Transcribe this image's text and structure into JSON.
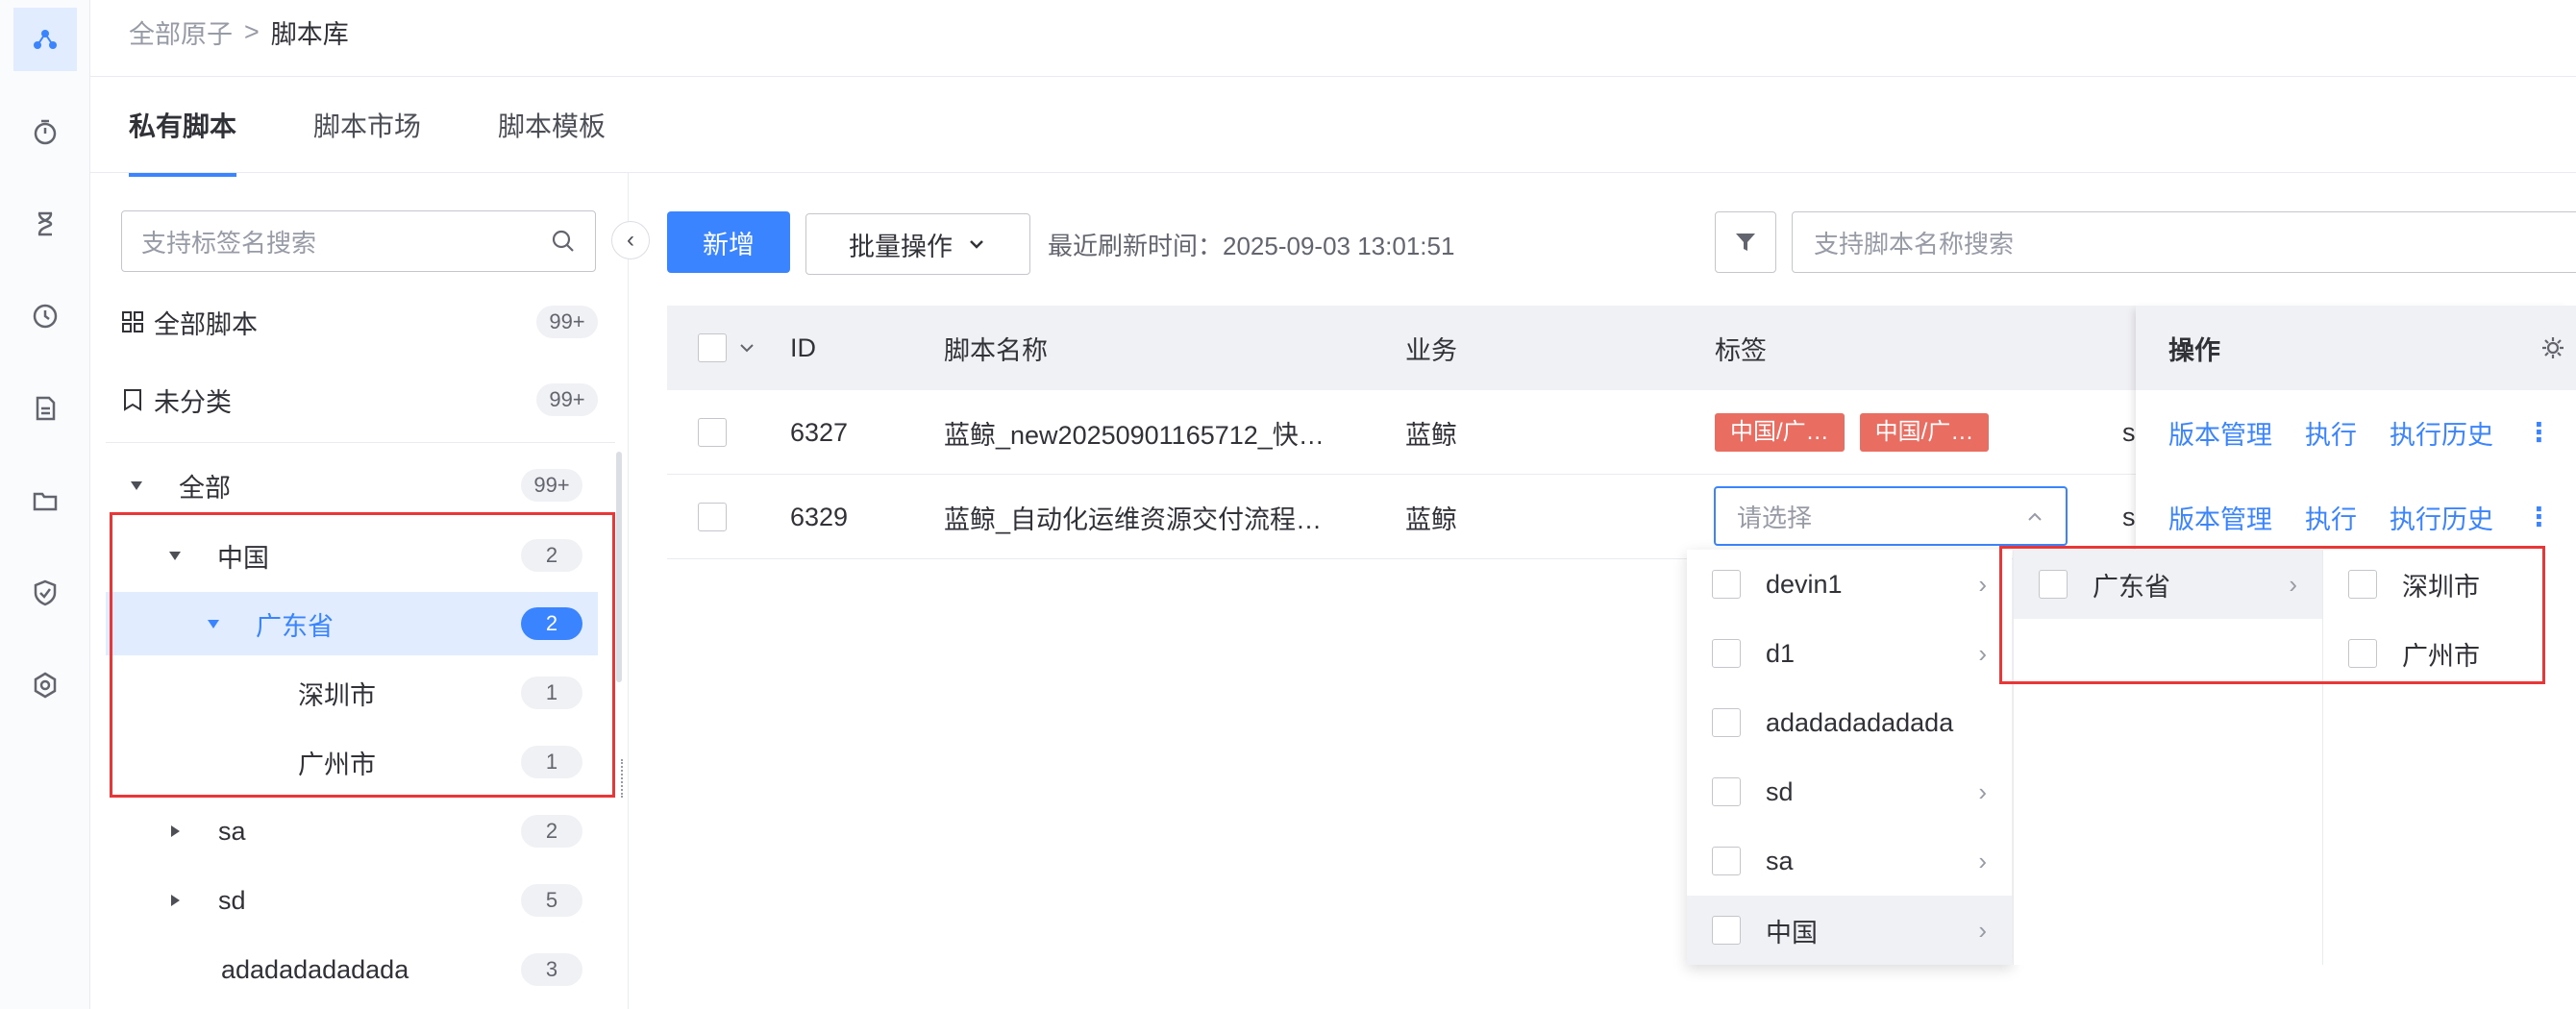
{
  "breadcrumb": {
    "root": "全部原子",
    "separator": ">",
    "current": "脚本库"
  },
  "tabs": [
    "私有脚本",
    "脚本市场",
    "脚本模板"
  ],
  "sidebar": {
    "search_placeholder": "支持标签名搜索",
    "all_scripts": {
      "label": "全部脚本",
      "count": "99+"
    },
    "uncategorized": {
      "label": "未分类",
      "count": "99+"
    },
    "tree": [
      {
        "label": "全部",
        "count": "99+"
      },
      {
        "label": "中国",
        "count": "2"
      },
      {
        "label": "广东省",
        "count": "2"
      },
      {
        "label": "深圳市",
        "count": "1"
      },
      {
        "label": "广州市",
        "count": "1"
      },
      {
        "label": "sa",
        "count": "2"
      },
      {
        "label": "sd",
        "count": "5"
      },
      {
        "label": "adadadadadada",
        "count": "3"
      }
    ]
  },
  "toolbar": {
    "new_label": "新增",
    "batch_label": "批量操作",
    "refresh_text": "最近刷新时间：2025-09-03 13:01:51",
    "search_placeholder": "支持脚本名称搜索"
  },
  "table": {
    "headers": {
      "id": "ID",
      "name": "脚本名称",
      "business": "业务",
      "tags": "标签",
      "ops": "操作"
    },
    "rows": [
      {
        "id": "6327",
        "name": "蓝鲸_new20250901165712_快…",
        "business": "蓝鲸",
        "tags": [
          "中国/广…",
          "中国/广…"
        ],
        "extra": "s"
      },
      {
        "id": "6329",
        "name": "蓝鲸_自动化运维资源交付流程…",
        "business": "蓝鲸",
        "select_placeholder": "请选择",
        "extra": "s"
      }
    ],
    "ops": [
      "版本管理",
      "执行",
      "执行历史"
    ]
  },
  "cascader": {
    "level1": [
      "devin1",
      "d1",
      "adadadadadada",
      "sd",
      "sa",
      "中国"
    ],
    "level2": [
      "广东省"
    ],
    "level3": [
      "深圳市",
      "广州市"
    ]
  },
  "colors": {
    "primary": "#3a84ff",
    "tag": "#ea6d62",
    "highlight": "#ea3636"
  }
}
